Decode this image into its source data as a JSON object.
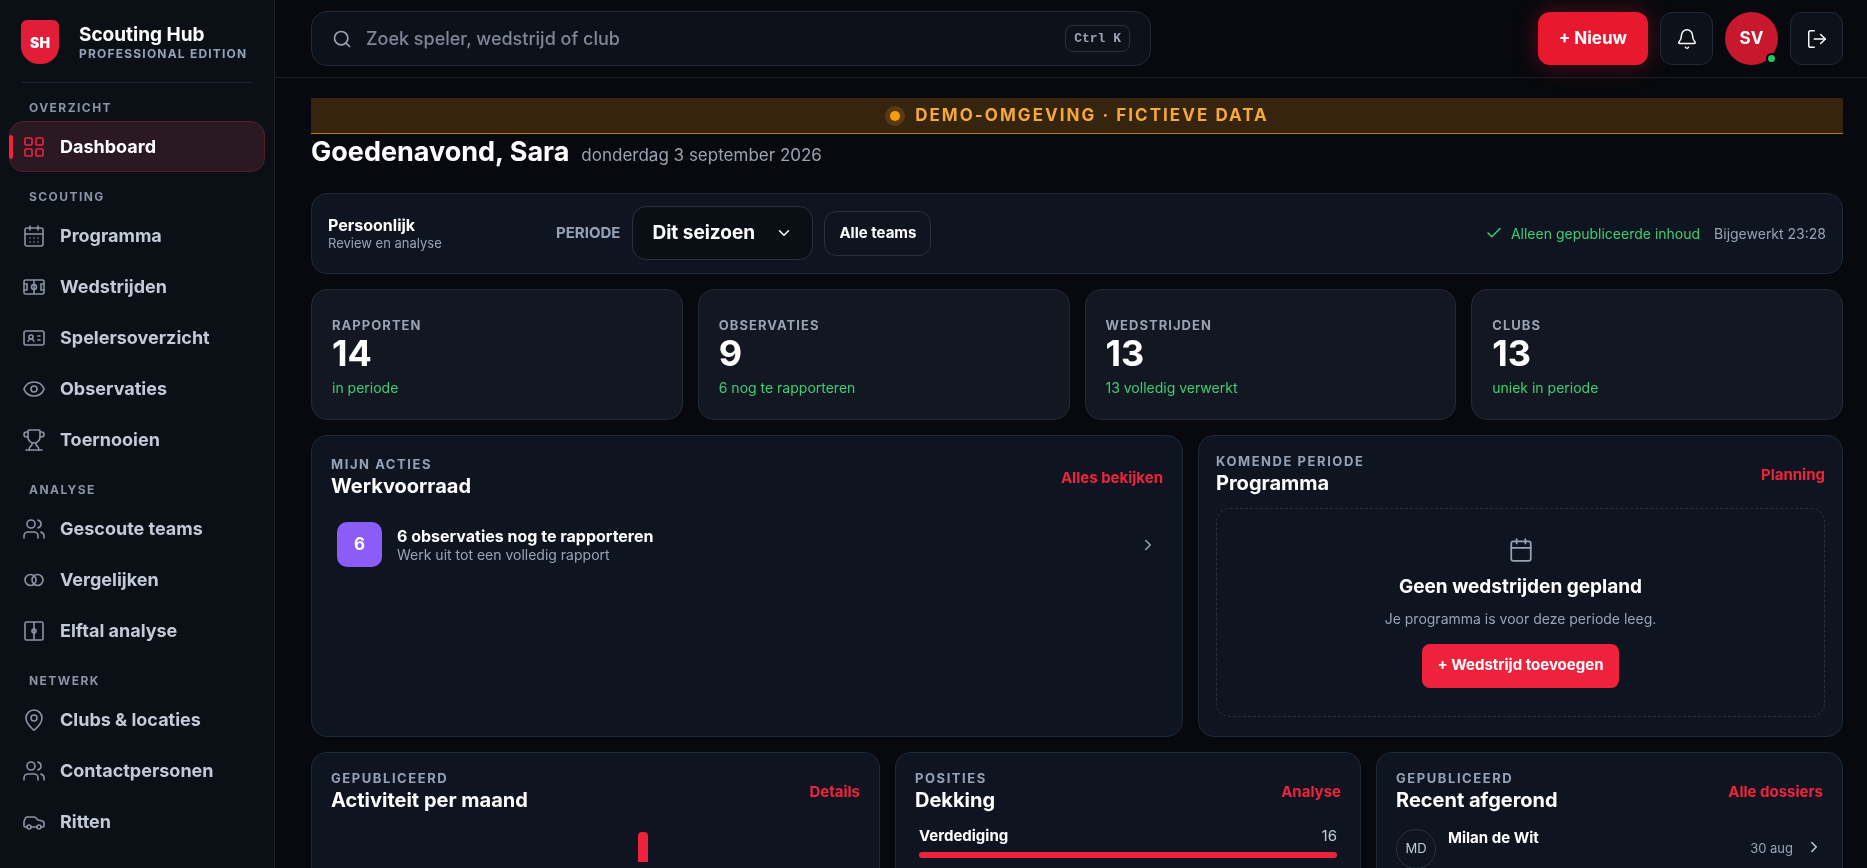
{
  "brand": {
    "logo": "SH",
    "name": "Scouting Hub",
    "edition": "PROFESSIONAL EDITION"
  },
  "sidebar": {
    "sections": [
      {
        "title": "OVERZICHT",
        "items": [
          {
            "label": "Dashboard",
            "kind": "grid",
            "selected": true
          }
        ]
      },
      {
        "title": "SCOUTING",
        "items": [
          {
            "label": "Programma",
            "kind": "calendar",
            "selected": false
          },
          {
            "label": "Wedstrijden",
            "kind": "pitch",
            "selected": false
          },
          {
            "label": "Spelersoverzicht",
            "kind": "idcard",
            "selected": false
          },
          {
            "label": "Observaties",
            "kind": "eye",
            "selected": false
          },
          {
            "label": "Toernooien",
            "kind": "trophy",
            "selected": false
          }
        ]
      },
      {
        "title": "ANALYSE",
        "items": [
          {
            "label": "Gescoute teams",
            "kind": "users",
            "selected": false
          },
          {
            "label": "Vergelijken",
            "kind": "circles",
            "selected": false
          },
          {
            "label": "Elftal analyse",
            "kind": "field",
            "selected": false
          }
        ]
      },
      {
        "title": "NETWERK",
        "items": [
          {
            "label": "Clubs & locaties",
            "kind": "pin",
            "selected": false
          },
          {
            "label": "Contactpersonen",
            "kind": "users",
            "selected": false
          },
          {
            "label": "Ritten",
            "kind": "car",
            "selected": false
          }
        ]
      }
    ]
  },
  "topbar": {
    "search": {
      "placeholder": "Zoek speler, wedstrijd of club",
      "shortcut": "Ctrl K"
    },
    "new_button": "+ Nieuw",
    "avatar": {
      "initials": "SV",
      "online": true
    }
  },
  "banner": "DEMO-OMGEVING · FICTIEVE DATA",
  "greeting": {
    "title": "Goedenavond, Sara",
    "date": "donderdag 3 september 2026"
  },
  "filters": {
    "title": "Persoonlijk",
    "subtitle": "Review en analyse",
    "period_label": "PERIODE",
    "period_value": "Dit seizoen",
    "teams_button": "Alle teams",
    "published_note": "Alleen gepubliceerde inhoud",
    "updated": "Bijgewerkt 23:28"
  },
  "stats": [
    {
      "label": "RAPPORTEN",
      "value": "14",
      "note": "in periode"
    },
    {
      "label": "OBSERVATIES",
      "value": "9",
      "note": "6 nog te rapporteren"
    },
    {
      "label": "WEDSTRIJDEN",
      "value": "13",
      "note": "13 volledig verwerkt"
    },
    {
      "label": "CLUBS",
      "value": "13",
      "note": "uniek in periode"
    }
  ],
  "actions": {
    "eyebrow": "MIJN ACTIES",
    "title": "Werkvoorraad",
    "link": "Alles bekijken",
    "items": [
      {
        "count": "6",
        "title": "6 observaties nog te rapporteren",
        "subtitle": "Werk uit tot een volledig rapport",
        "color": "#8b5cf6"
      }
    ]
  },
  "program": {
    "eyebrow": "KOMENDE PERIODE",
    "title": "Programma",
    "link": "Planning",
    "empty_title": "Geen wedstrijden gepland",
    "empty_text": "Je programma is voor deze periode leeg.",
    "button": "+ Wedstrijd toevoegen"
  },
  "activity": {
    "eyebrow": "GEPUBLICEERD",
    "title": "Activiteit per maand",
    "link": "Details"
  },
  "coverage": {
    "eyebrow": "POSITIES",
    "title": "Dekking",
    "link": "Analyse",
    "rows": [
      {
        "label": "Verdediging",
        "count": "16",
        "level": 1
      }
    ]
  },
  "recent": {
    "eyebrow": "GEPUBLICEERD",
    "title": "Recent afgerond",
    "link": "Alle dossiers",
    "items": [
      {
        "initials": "MD",
        "name": "Milan de Wit",
        "date": "30 aug"
      }
    ]
  }
}
